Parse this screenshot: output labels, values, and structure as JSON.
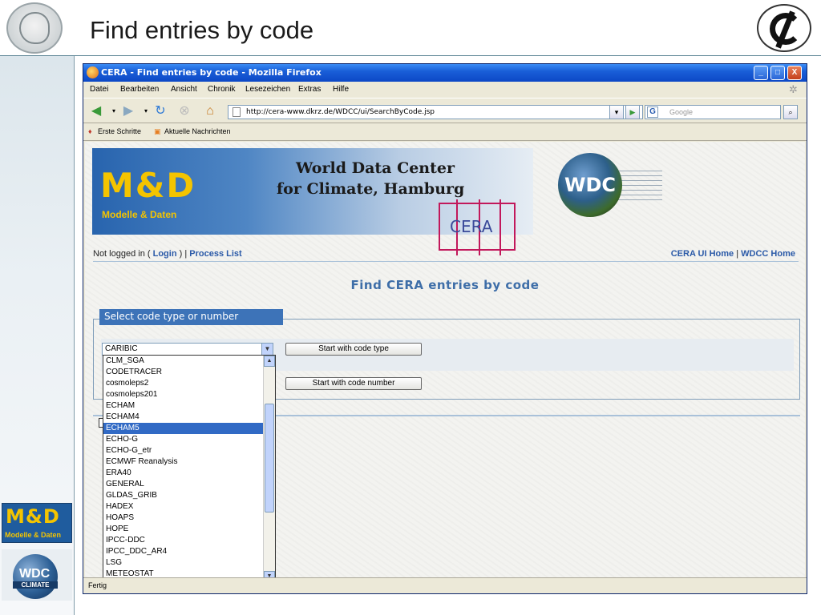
{
  "slide": {
    "title": "Find entries by code"
  },
  "window": {
    "title": "CERA - Find entries by code - Mozilla Firefox",
    "minimize": "_",
    "maximize": "□",
    "close": "X"
  },
  "menubar": [
    "Datei",
    "Bearbeiten",
    "Ansicht",
    "Chronik",
    "Lesezeichen",
    "Extras",
    "Hilfe"
  ],
  "navbar": {
    "url": "http://cera-www.dkrz.de/WDCC/ui/SearchByCode.jsp",
    "search_placeholder": "Google",
    "search_engine_icon": "G"
  },
  "bookmarks": [
    "Erste Schritte",
    "Aktuelle Nachrichten"
  ],
  "banner": {
    "md_text": "M&D",
    "md_sub": "Modelle & Daten",
    "wdc_line1": "World Data Center",
    "wdc_line2": "for Climate, Hamburg",
    "cera": "CERA",
    "wdc_globe": "WDC"
  },
  "login": {
    "prefix": "Not logged in (",
    "login": "Login",
    "middle": ") |",
    "process_list": "Process List",
    "cera_home": "CERA UI Home",
    "sep": "|",
    "wdcc_home": "WDCC Home"
  },
  "page": {
    "heading": "Find CERA entries by code",
    "legend": "Select code type or number",
    "selected_value": "CARIBIC",
    "btn_type": "Start with code type",
    "btn_number": "Start with code number"
  },
  "dropdown_items": [
    "CLM_SGA",
    "CODETRACER",
    "cosmoleps2",
    "cosmoleps201",
    "ECHAM",
    "ECHAM4",
    "ECHAM5",
    "ECHO-G",
    "ECHO-G_etr",
    "ECMWF Reanalysis",
    "ERA40",
    "GENERAL",
    "GLDAS_GRIB",
    "HADEX",
    "HOAPS",
    "HOPE",
    "IPCC-DDC",
    "IPCC_DDC_AR4",
    "LSG",
    "METEOSTAT"
  ],
  "dropdown_selected": "ECHAM5",
  "status": "Fertig",
  "side_logos": {
    "md_text": "M&D",
    "md_sub": "Modelle & Daten",
    "wdc": "WDC",
    "climate": "CLIMATE"
  },
  "colors": {
    "titlebar": "#0c48c6",
    "link": "#2b5aa8",
    "heading": "#3e6ea8",
    "legend_bg": "#3d73b8",
    "selection": "#316ac5"
  }
}
